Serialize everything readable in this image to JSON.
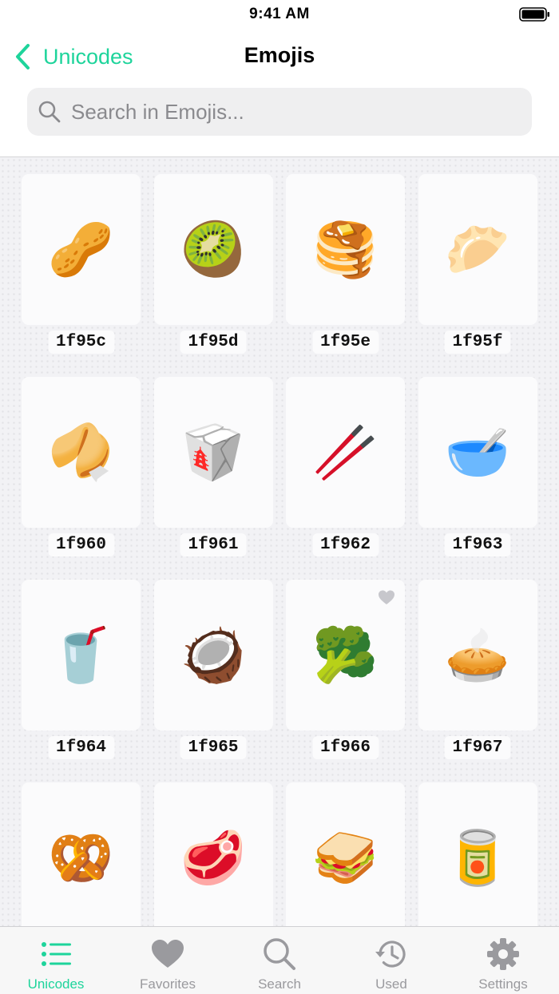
{
  "status_bar": {
    "time": "9:41 AM"
  },
  "nav": {
    "back_label": "Unicodes",
    "title": "Emojis"
  },
  "search": {
    "placeholder": "Search in Emojis...",
    "value": ""
  },
  "colors": {
    "accent": "#1ed49b",
    "inactive": "#9a9a9e"
  },
  "emojis": [
    {
      "glyph": "🥜",
      "code": "1f95c",
      "favorite": false
    },
    {
      "glyph": "🥝",
      "code": "1f95d",
      "favorite": false
    },
    {
      "glyph": "🥞",
      "code": "1f95e",
      "favorite": false
    },
    {
      "glyph": "🥟",
      "code": "1f95f",
      "favorite": false
    },
    {
      "glyph": "🥠",
      "code": "1f960",
      "favorite": false
    },
    {
      "glyph": "🥡",
      "code": "1f961",
      "favorite": false
    },
    {
      "glyph": "🥢",
      "code": "1f962",
      "favorite": false
    },
    {
      "glyph": "🥣",
      "code": "1f963",
      "favorite": false
    },
    {
      "glyph": "🥤",
      "code": "1f964",
      "favorite": false
    },
    {
      "glyph": "🥥",
      "code": "1f965",
      "favorite": false
    },
    {
      "glyph": "🥦",
      "code": "1f966",
      "favorite": true
    },
    {
      "glyph": "🥧",
      "code": "1f967",
      "favorite": false
    },
    {
      "glyph": "🥨",
      "code": "",
      "favorite": false
    },
    {
      "glyph": "🥩",
      "code": "",
      "favorite": false
    },
    {
      "glyph": "🥪",
      "code": "",
      "favorite": false
    },
    {
      "glyph": "🥫",
      "code": "",
      "favorite": false
    }
  ],
  "tabs": [
    {
      "label": "Unicodes",
      "icon": "list-icon",
      "active": true
    },
    {
      "label": "Favorites",
      "icon": "heart-icon",
      "active": false
    },
    {
      "label": "Search",
      "icon": "search-icon",
      "active": false
    },
    {
      "label": "Used",
      "icon": "history-icon",
      "active": false
    },
    {
      "label": "Settings",
      "icon": "gear-icon",
      "active": false
    }
  ]
}
